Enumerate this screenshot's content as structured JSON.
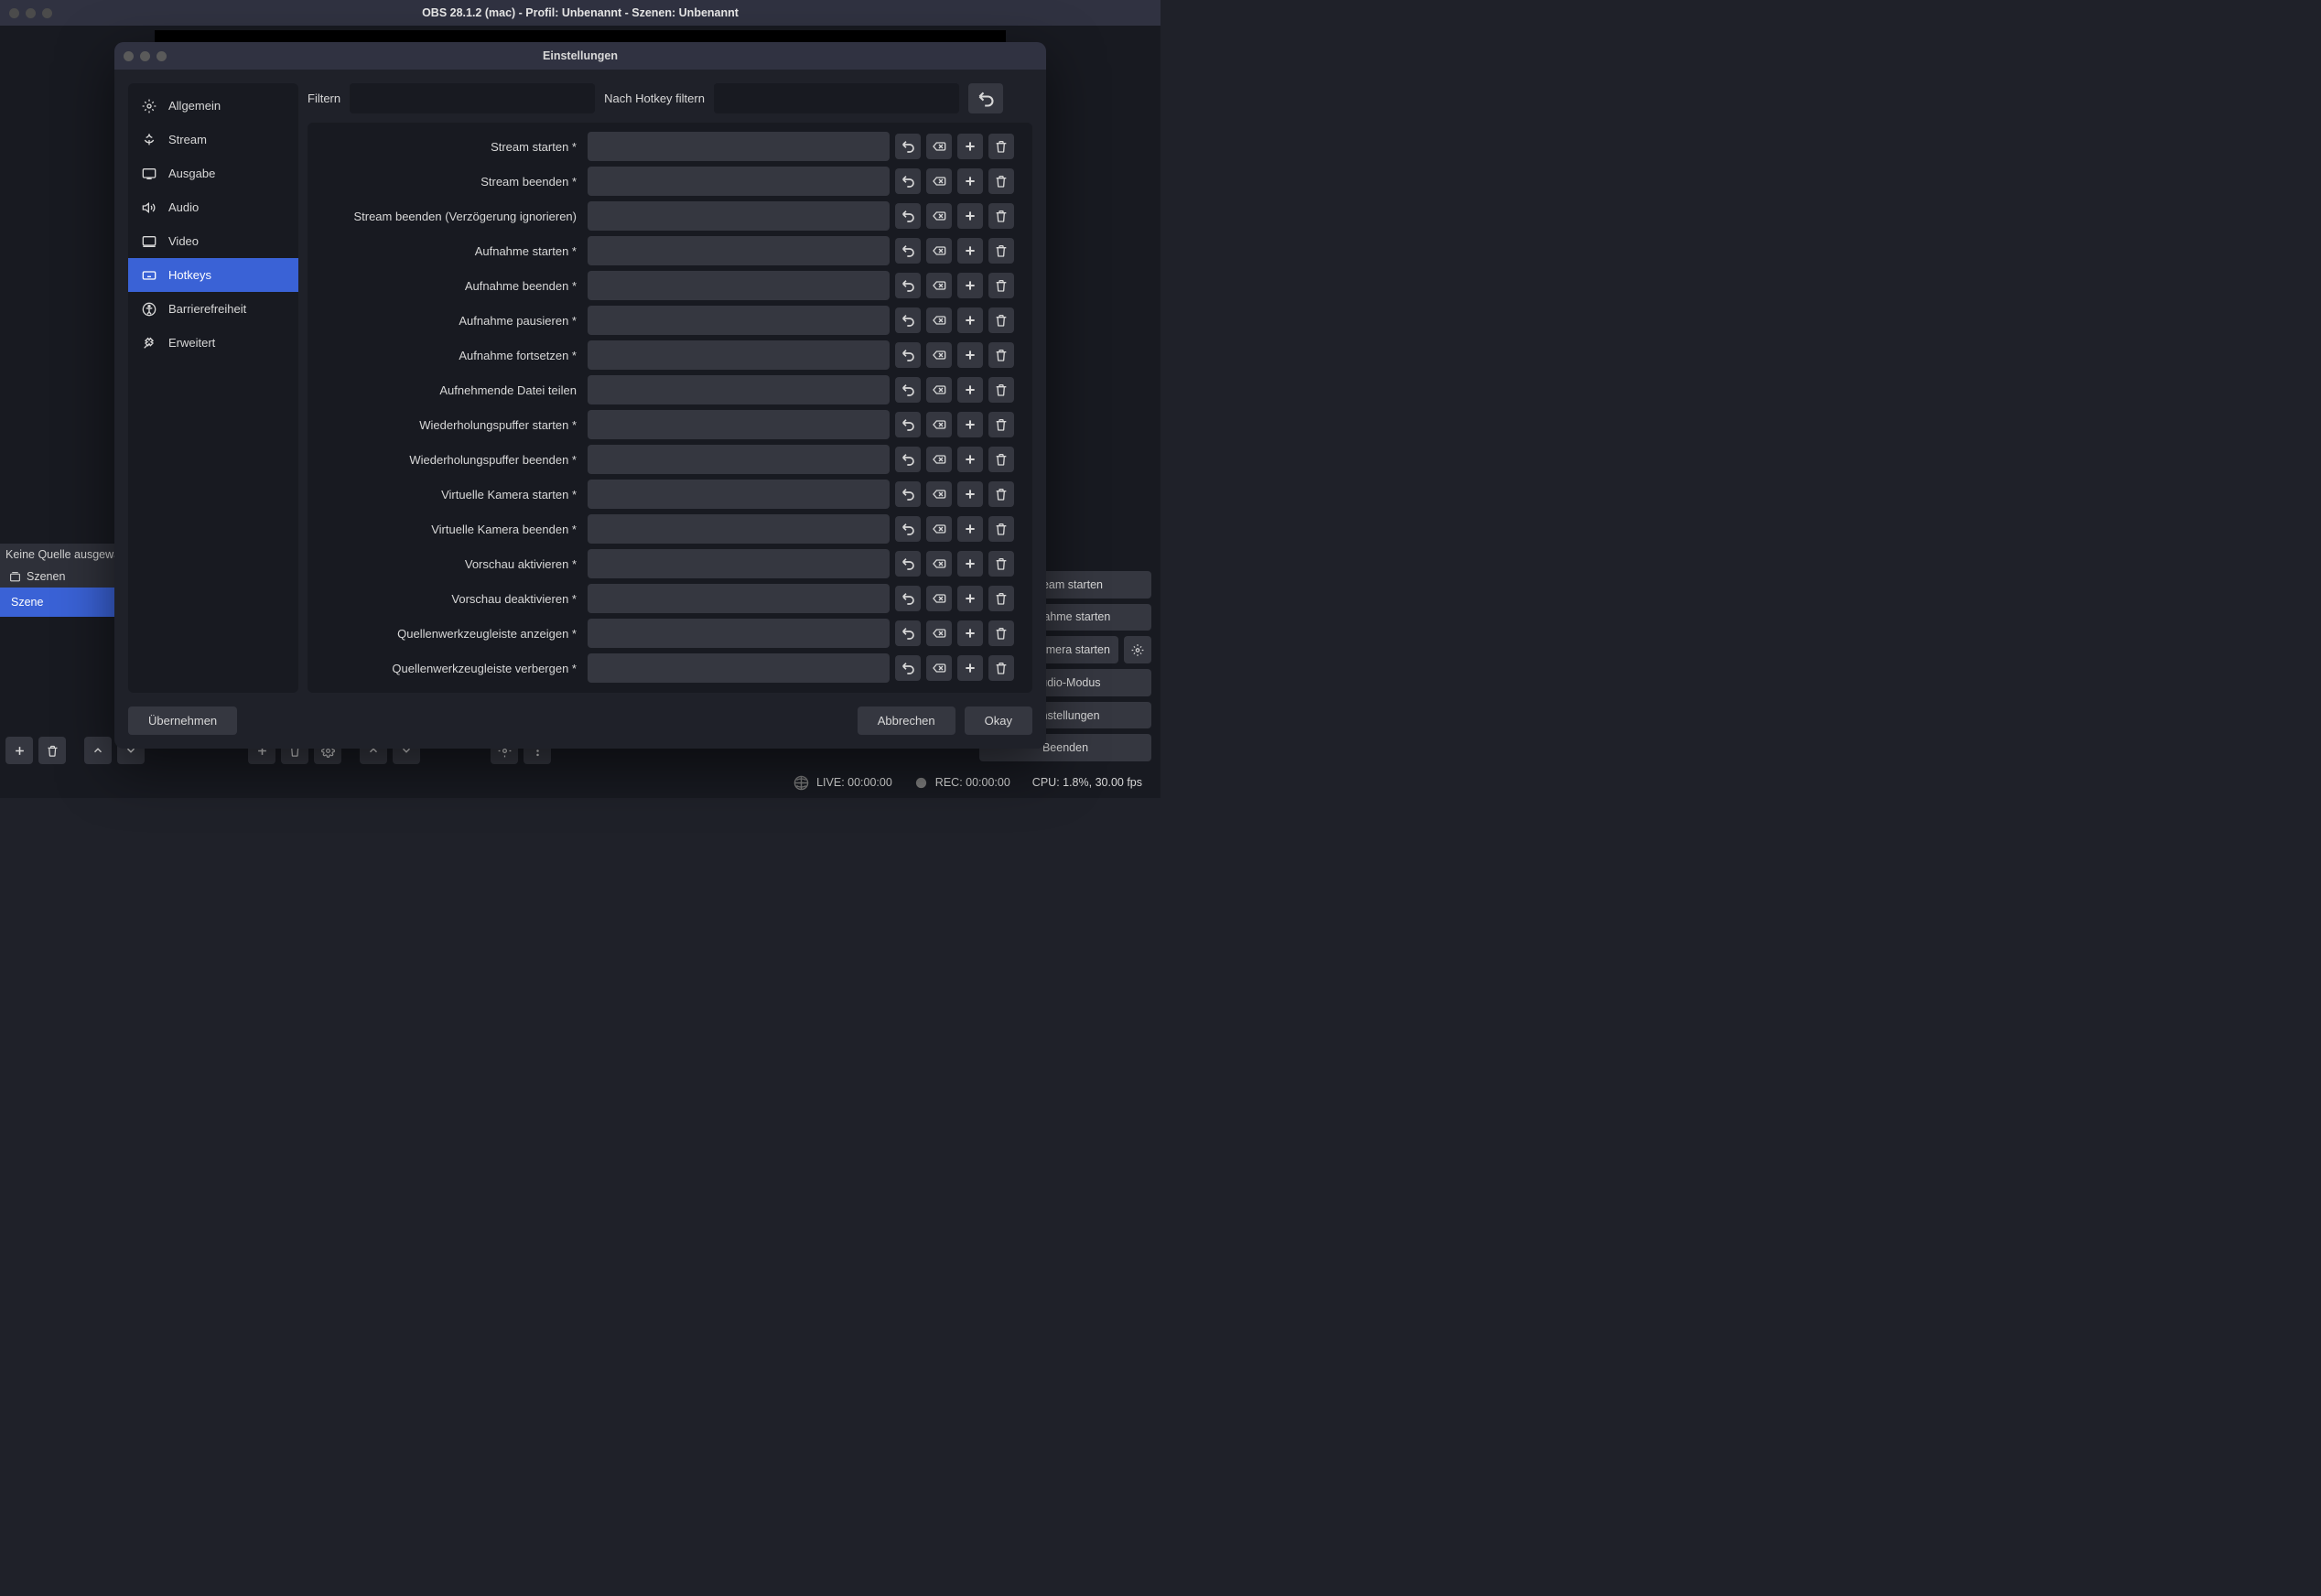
{
  "window": {
    "title": "OBS 28.1.2 (mac) - Profil: Unbenannt - Szenen: Unbenannt"
  },
  "main": {
    "no_source_label": "Keine Quelle ausgewählt",
    "scenes_panel_title": "Szenen",
    "scene_items": [
      "Szene"
    ]
  },
  "controls": {
    "stream": "Stream starten",
    "record": "Aufnahme starten",
    "vcam": "Virtuelle Kamera starten",
    "studio": "Studio-Modus",
    "settings": "Einstellungen",
    "exit": "Beenden"
  },
  "status": {
    "live": "LIVE: 00:00:00",
    "rec": "REC: 00:00:00",
    "cpu": "CPU: 1.8%, 30.00 fps"
  },
  "dialog": {
    "title": "Einstellungen",
    "filter_label": "Filtern",
    "filter_hotkey_label": "Nach Hotkey filtern",
    "sidebar": [
      {
        "id": "general",
        "label": "Allgemein"
      },
      {
        "id": "stream",
        "label": "Stream"
      },
      {
        "id": "output",
        "label": "Ausgabe"
      },
      {
        "id": "audio",
        "label": "Audio"
      },
      {
        "id": "video",
        "label": "Video"
      },
      {
        "id": "hotkeys",
        "label": "Hotkeys"
      },
      {
        "id": "accessibility",
        "label": "Barrierefreiheit"
      },
      {
        "id": "advanced",
        "label": "Erweitert"
      }
    ],
    "active_sidebar": "hotkeys",
    "hotkeys": [
      "Stream starten *",
      "Stream beenden *",
      "Stream beenden (Verzögerung ignorieren)",
      "Aufnahme starten *",
      "Aufnahme beenden *",
      "Aufnahme pausieren *",
      "Aufnahme fortsetzen *",
      "Aufnehmende Datei teilen",
      "Wiederholungspuffer starten *",
      "Wiederholungspuffer beenden *",
      "Virtuelle Kamera starten *",
      "Virtuelle Kamera beenden *",
      "Vorschau aktivieren *",
      "Vorschau deaktivieren *",
      "Quellenwerkzeugleiste anzeigen *",
      "Quellenwerkzeugleiste verbergen *"
    ],
    "apply": "Übernehmen",
    "cancel": "Abbrechen",
    "ok": "Okay"
  }
}
